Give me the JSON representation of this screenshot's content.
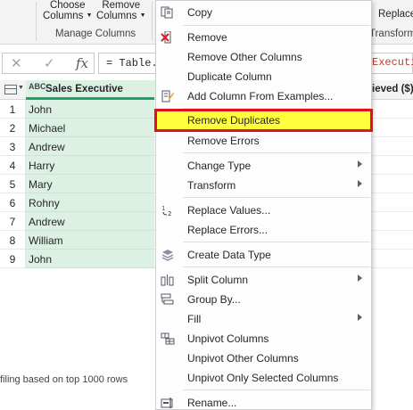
{
  "ribbon": {
    "choose_columns": {
      "line1": "Choose",
      "line2": "Columns"
    },
    "remove_columns": {
      "line1": "Remove",
      "line2": "Columns"
    },
    "manage_group": "Manage Columns",
    "replace": "Replace",
    "transform_group": "Transform"
  },
  "formula": {
    "cancel_glyph": "✕",
    "confirm_glyph": "✓",
    "fx_glyph": "fx",
    "text": "= Table.",
    "text_red": "Executi"
  },
  "grid": {
    "column_header": "Sales Executive",
    "column_type_icon": "ABC",
    "right_column_header": "ieved ($)",
    "rows": [
      {
        "num": "1",
        "value": "John"
      },
      {
        "num": "2",
        "value": "Michael"
      },
      {
        "num": "3",
        "value": "Andrew"
      },
      {
        "num": "4",
        "value": "Harry"
      },
      {
        "num": "5",
        "value": "Mary"
      },
      {
        "num": "6",
        "value": "Rohny"
      },
      {
        "num": "7",
        "value": "Andrew"
      },
      {
        "num": "8",
        "value": "William"
      },
      {
        "num": "9",
        "value": "John"
      }
    ],
    "status": "filing based on top 1000 rows"
  },
  "menu": {
    "copy": "Copy",
    "remove": "Remove",
    "remove_other_columns": "Remove Other Columns",
    "duplicate_column": "Duplicate Column",
    "add_column_from_examples": "Add Column From Examples...",
    "remove_duplicates": "Remove Duplicates",
    "remove_errors": "Remove Errors",
    "change_type": "Change Type",
    "transform": "Transform",
    "replace_values": "Replace Values...",
    "replace_errors": "Replace Errors...",
    "create_data_type": "Create Data Type",
    "split_column": "Split Column",
    "group_by": "Group By...",
    "fill": "Fill",
    "unpivot_columns": "Unpivot Columns",
    "unpivot_other_columns": "Unpivot Other Columns",
    "unpivot_only_selected_columns": "Unpivot Only Selected Columns",
    "rename": "Rename..."
  },
  "icons": {
    "copy": "copy-icon",
    "remove": "remove-column-icon",
    "add_column_from_examples": "add-column-icon",
    "replace_values": "replace-values-icon",
    "create_data_type": "data-type-icon",
    "split_column": "split-column-icon",
    "group_by": "group-by-icon",
    "unpivot_columns": "unpivot-icon",
    "rename": "rename-icon"
  },
  "colors": {
    "highlight": "#ffff3c",
    "highlight_border": "#e0101e",
    "column_fill": "#dcf0e4",
    "column_accent": "#1aa168"
  }
}
